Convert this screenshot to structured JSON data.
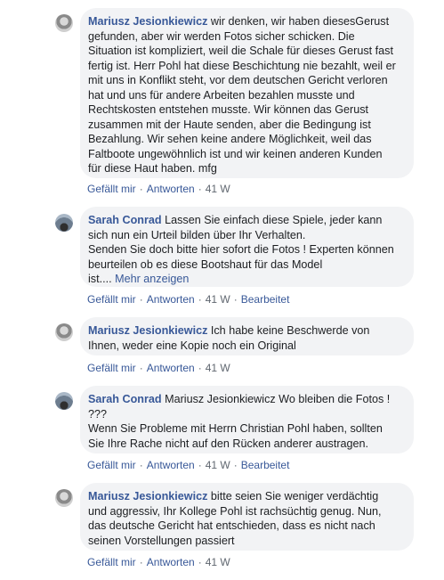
{
  "comments": [
    {
      "author": "Mariusz Jesionkiewicz",
      "text": "wir denken, wir haben diesesGerust\ngefunden, aber wir werden Fotos sicher schicken. Die\nSituation ist kompliziert, weil die Schale für dieses Gerust fast\nfertig ist. Herr Pohl hat diese Beschichtung nie bezahlt, weil er\nmit uns in Konflikt steht, vor dem deutschen Gericht verloren\nhat und uns für andere Arbeiten bezahlen musste und\nRechtskosten entstehen musste. Wir können das Gerust\nzusammen mit der Haute senden, aber die Bedingung ist\nBezahlung. Wir sehen keine andere Möglichkeit, weil das\nFaltboote ungewöhnlich ist und wir keinen anderen Kunden\nfür diese Haut haben. mfg",
      "like": "Gefällt mir",
      "reply": "Antworten",
      "time": "41 W"
    },
    {
      "author": "Sarah Conrad",
      "text": "Lassen Sie einfach diese Spiele, jeder kann\nsich nun ein Urteil bilden über Ihr Verhalten.\nSenden Sie doch bitte hier sofort die Fotos ! Experten können\nbeurteilen ob es diese Bootshaut für das Model\nist....",
      "more": "Mehr anzeigen",
      "like": "Gefällt mir",
      "reply": "Antworten",
      "time": "41 W",
      "edited": "Bearbeitet"
    },
    {
      "author": "Mariusz Jesionkiewicz",
      "text": "Ich habe keine Beschwerde von\nIhnen, weder eine Kopie noch ein Original",
      "like": "Gefällt mir",
      "reply": "Antworten",
      "time": "41 W"
    },
    {
      "author": "Sarah Conrad",
      "text": "Mariusz Jesionkiewicz Wo bleiben die Fotos !\n???\nWenn Sie Probleme mit Herrn Christian Pohl haben, sollten\nSie Ihre Rache nicht auf den Rücken anderer austragen.",
      "like": "Gefällt mir",
      "reply": "Antworten",
      "time": "41 W",
      "edited": "Bearbeitet"
    },
    {
      "author": "Mariusz Jesionkiewicz",
      "text": "bitte seien Sie weniger verdächtig\nund aggressiv, Ihr Kollege Pohl ist rachsüchtig genug. Nun,\ndas deutsche Gericht hat entschieden, dass es nicht nach\nseinen Vorstellungen passiert",
      "like": "Gefällt mir",
      "reply": "Antworten",
      "time": "41 W"
    }
  ]
}
